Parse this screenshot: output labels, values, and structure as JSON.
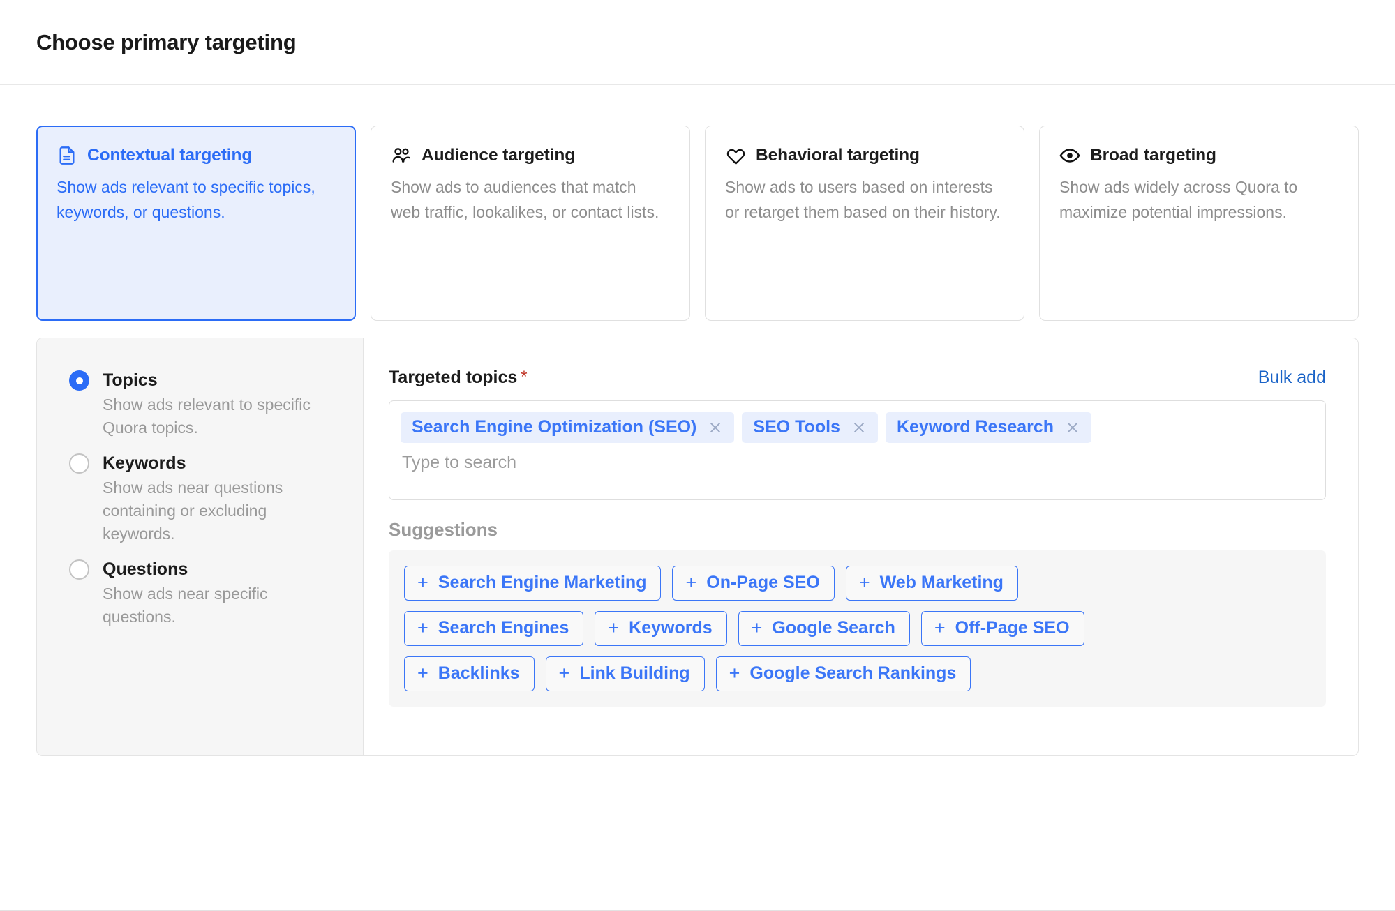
{
  "header": {
    "title": "Choose primary targeting"
  },
  "targeting_cards": [
    {
      "icon": "document-icon",
      "title": "Contextual targeting",
      "description": "Show ads relevant to specific topics, keywords, or questions.",
      "selected": true
    },
    {
      "icon": "people-icon",
      "title": "Audience targeting",
      "description": "Show ads to audiences that match web traffic, lookalikes, or contact lists.",
      "selected": false
    },
    {
      "icon": "heart-icon",
      "title": "Behavioral targeting",
      "description": "Show ads to users based on interests or retarget them based on their history.",
      "selected": false
    },
    {
      "icon": "eye-icon",
      "title": "Broad targeting",
      "description": "Show ads widely across Quora to maximize potential impressions.",
      "selected": false
    }
  ],
  "mode_options": [
    {
      "label": "Topics",
      "description": "Show ads relevant to specific Quora topics.",
      "selected": true
    },
    {
      "label": "Keywords",
      "description": "Show ads near questions containing or excluding keywords.",
      "selected": false
    },
    {
      "label": "Questions",
      "description": "Show ads near specific questions.",
      "selected": false
    }
  ],
  "targeted_topics": {
    "label": "Targeted topics",
    "required_marker": "*",
    "bulk_add_label": "Bulk add",
    "input_value": "",
    "input_placeholder": "Type to search",
    "chips": [
      {
        "label": "Search Engine Optimization (SEO)",
        "remove_icon": "close-icon"
      },
      {
        "label": "SEO Tools",
        "remove_icon": "close-icon"
      },
      {
        "label": "Keyword Research",
        "remove_icon": "close-icon"
      }
    ]
  },
  "suggestions": {
    "title": "Suggestions",
    "add_icon": "plus-icon",
    "rows": [
      [
        "Search Engine Marketing",
        "On-Page SEO",
        "Web Marketing"
      ],
      [
        "Search Engines",
        "Keywords",
        "Google Search",
        "Off-Page SEO"
      ],
      [
        "Backlinks",
        "Link Building",
        "Google Search Rankings"
      ]
    ]
  },
  "colors": {
    "accent_blue": "#3b76f7",
    "link_blue": "#1a63c7",
    "selected_card_bg": "#e9effd",
    "muted_text": "#8d8d8d",
    "required_red": "#c0392b"
  }
}
